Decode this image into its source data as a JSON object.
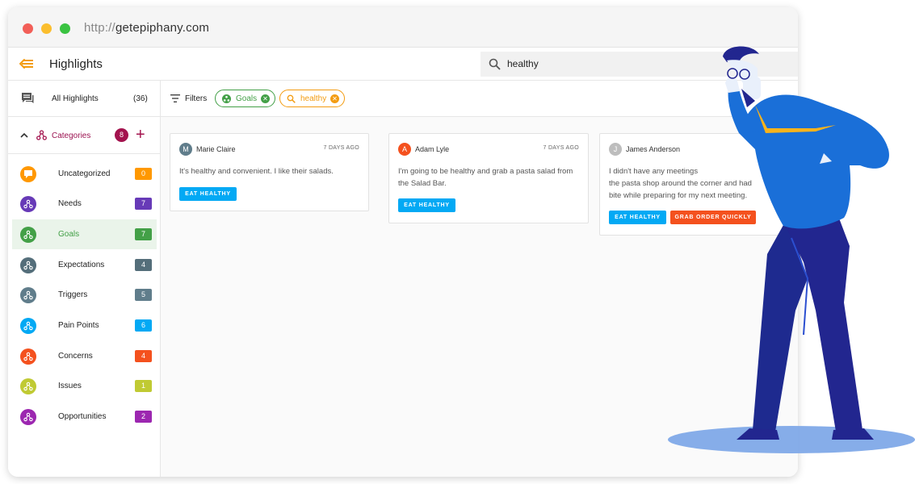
{
  "window": {
    "url_protocol": "http://",
    "url_host": "getepiphany.com"
  },
  "header": {
    "title": "Highlights",
    "search_value": "healthy"
  },
  "sidebar": {
    "all_highlights_label": "All Highlights",
    "all_highlights_count": "(36)",
    "categories_label": "Categories",
    "categories_count": "8",
    "add_label": "+",
    "items": [
      {
        "label": "Uncategorized",
        "count": "0",
        "color": "#ff9800"
      },
      {
        "label": "Needs",
        "count": "7",
        "color": "#673ab7"
      },
      {
        "label": "Goals",
        "count": "7",
        "color": "#43a047"
      },
      {
        "label": "Expectations",
        "count": "4",
        "color": "#546e7a"
      },
      {
        "label": "Triggers",
        "count": "5",
        "color": "#607d8b"
      },
      {
        "label": "Pain Points",
        "count": "6",
        "color": "#03a9f4"
      },
      {
        "label": "Concerns",
        "count": "4",
        "color": "#f4511e"
      },
      {
        "label": "Issues",
        "count": "1",
        "color": "#c0ca33"
      },
      {
        "label": "Opportunities",
        "count": "2",
        "color": "#9c27b0"
      }
    ],
    "active_item": "Goals"
  },
  "filters": {
    "label": "Filters",
    "chips": [
      {
        "label": "Goals",
        "color": "#43a047",
        "icon": "category-icon"
      },
      {
        "label": "healthy",
        "color": "#f39c12",
        "icon": "search-icon"
      }
    ]
  },
  "cards": [
    {
      "author": "Marie Claire",
      "initial": "M",
      "avatar_color": "#607d8b",
      "date": "7 DAYS AGO",
      "text_lines": [
        "It's healthy and convenient. I like their salads."
      ],
      "tags": [
        {
          "label": "EAT HEALTHY",
          "color": "#03a9f4"
        }
      ]
    },
    {
      "author": "Adam Lyle",
      "initial": "A",
      "avatar_color": "#f4511e",
      "date": "7 DAYS AGO",
      "text_lines": [
        "I'm going to be healthy and grab a pasta salad from",
        "the Salad Bar."
      ],
      "tags": [
        {
          "label": "EAT HEALTHY",
          "color": "#03a9f4"
        }
      ]
    },
    {
      "author": "James Anderson",
      "initial": "J",
      "avatar_color": "#bdbdbd",
      "date": "",
      "text_lines": [
        "I didn't have any meetings",
        "the pasta shop around the corner and had",
        "bite while preparing for my next meeting."
      ],
      "tags": [
        {
          "label": "EAT HEALTHY",
          "color": "#03a9f4"
        },
        {
          "label": "GRAB ORDER QUICKLY",
          "color": "#f4511e"
        }
      ]
    }
  ],
  "illustration": {
    "icon": "businessman-illustration",
    "colors": {
      "shirt": "#1a6fd8",
      "pants": "#22268f",
      "tie": "#f9b31c",
      "shadow": "#7fa9e8",
      "hair": "#22268f"
    }
  }
}
